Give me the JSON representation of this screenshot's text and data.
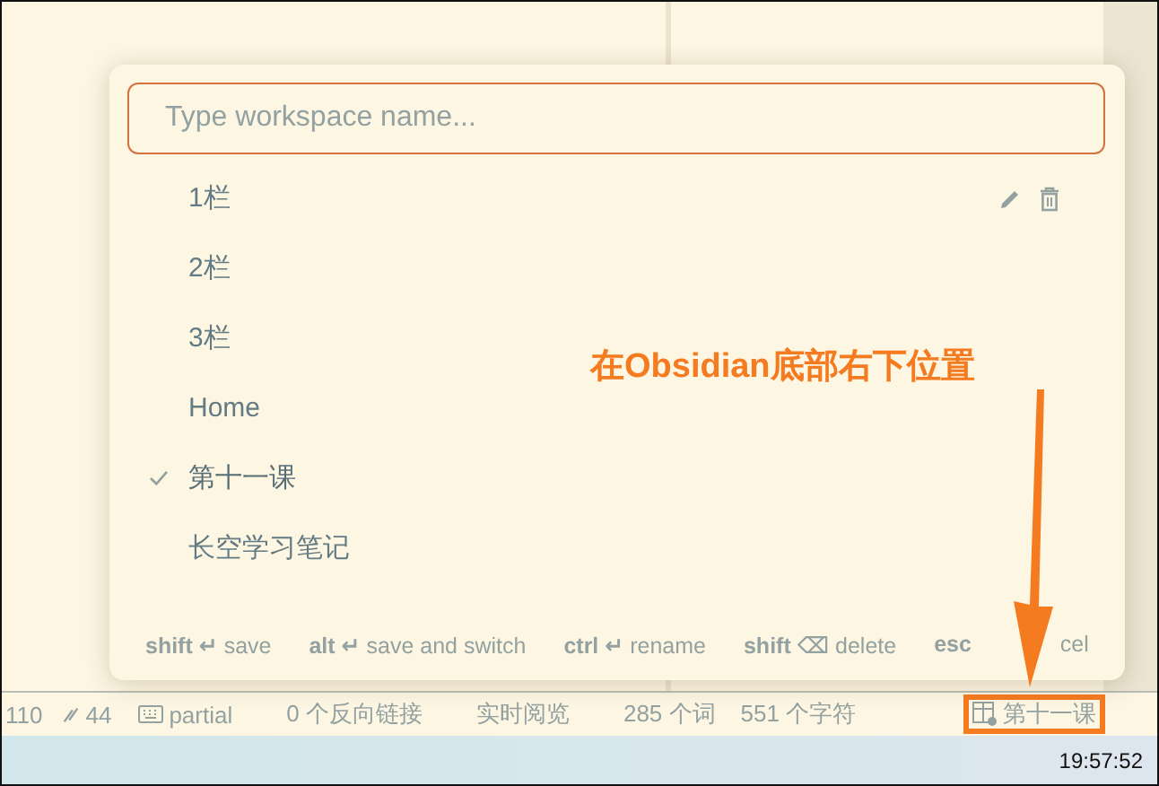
{
  "workspace_modal": {
    "input": {
      "placeholder": "Type workspace name..."
    },
    "items": [
      {
        "label": "1栏",
        "selected": false,
        "hovered": true
      },
      {
        "label": "2栏",
        "selected": false,
        "hovered": false
      },
      {
        "label": "3栏",
        "selected": false,
        "hovered": false
      },
      {
        "label": "Home",
        "selected": false,
        "hovered": false
      },
      {
        "label": "第十一课",
        "selected": true,
        "hovered": false
      },
      {
        "label": "长空学习笔记",
        "selected": false,
        "hovered": false
      }
    ],
    "hints": [
      {
        "key": "shift ↵",
        "label": "save"
      },
      {
        "key": "alt ↵",
        "label": "save and switch"
      },
      {
        "key": "ctrl ↵",
        "label": "rename"
      },
      {
        "key": "shift ⌫",
        "label": "delete"
      },
      {
        "key": "esc",
        "label": "cel"
      }
    ]
  },
  "annotation": {
    "text": "在Obsidian底部右下位置"
  },
  "status_bar": [
    {
      "kind": "text",
      "text": "110"
    },
    {
      "kind": "links",
      "text": "44"
    },
    {
      "kind": "keyboard",
      "text": "partial"
    },
    {
      "kind": "text",
      "text": "0 个反向链接"
    },
    {
      "kind": "text",
      "text": "实时阅览"
    },
    {
      "kind": "text",
      "text": "285 个词"
    },
    {
      "kind": "text",
      "text": "551 个字符"
    },
    {
      "kind": "workspace",
      "text": "第十一课",
      "highlighted": true
    }
  ],
  "taskbar": {
    "time": "19:57:52"
  }
}
